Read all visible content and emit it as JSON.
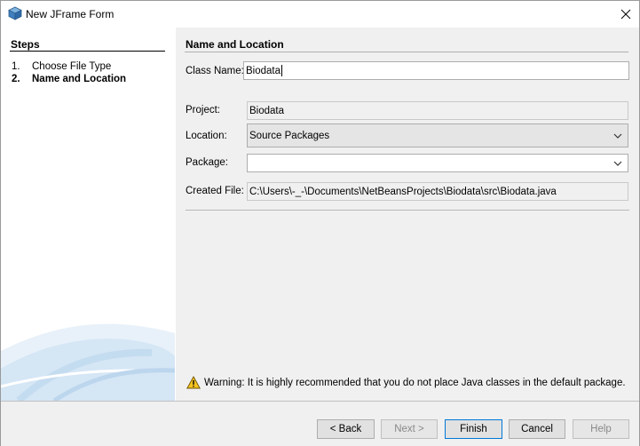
{
  "window": {
    "title": "New JFrame Form"
  },
  "steps": {
    "heading": "Steps",
    "items": [
      {
        "num": "1.",
        "label": "Choose File Type",
        "current": false
      },
      {
        "num": "2.",
        "label": "Name and Location",
        "current": true
      }
    ]
  },
  "main": {
    "heading": "Name and Location",
    "class_name": {
      "label": "Class Name:",
      "value": "Biodata"
    },
    "project": {
      "label": "Project:",
      "value": "Biodata"
    },
    "location": {
      "label": "Location:",
      "value": "Source Packages"
    },
    "package": {
      "label": "Package:",
      "value": ""
    },
    "created_file": {
      "label": "Created File:",
      "value": "C:\\Users\\-_-\\Documents\\NetBeansProjects\\Biodata\\src\\Biodata.java"
    },
    "warning": "Warning: It is highly recommended that you do not place Java classes in the default package."
  },
  "buttons": {
    "back": "< Back",
    "next": "Next >",
    "finish": "Finish",
    "cancel": "Cancel",
    "help": "Help"
  },
  "icons": {
    "app": "netbeans-cube-icon",
    "close": "close-icon",
    "warning": "warning-triangle-icon",
    "dropdown": "chevron-down-icon"
  }
}
